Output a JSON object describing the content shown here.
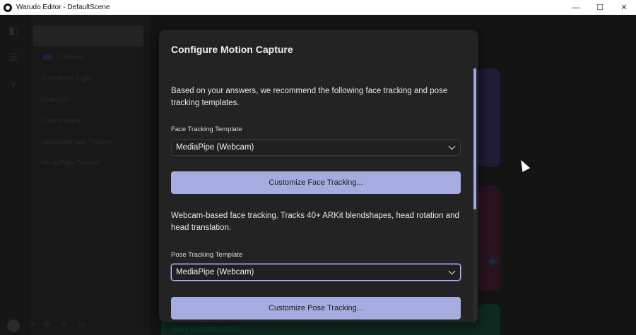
{
  "window": {
    "title": "Warudo Editor - DefaultScene",
    "minimize_glyph": "—",
    "maximize_glyph": "☐",
    "close_glyph": "✕"
  },
  "background": {
    "hierarchy": [
      "Camera",
      "Directional Light",
      "Character",
      "Environment",
      "OpenSeeFace Tracker",
      "MediaPipe Tracker"
    ],
    "footer_text": "Get Connected!"
  },
  "dialog": {
    "title": "Configure Motion Capture",
    "intro": "Based on your answers, we recommend the following face tracking and pose tracking templates.",
    "face": {
      "label": "Face Tracking Template",
      "value": "MediaPipe (Webcam)",
      "customize_button": "Customize Face Tracking...",
      "description": "Webcam-based face tracking. Tracks 40+ ARKit blendshapes, head rotation and head translation."
    },
    "pose": {
      "label": "Pose Tracking Template",
      "value": "MediaPipe (Webcam)",
      "customize_button": "Customize Pose Tracking..."
    }
  },
  "colors": {
    "accent_button": "#a5acdf",
    "dialog_bg": "#232323",
    "focus_ring": "#b4bcf0"
  }
}
